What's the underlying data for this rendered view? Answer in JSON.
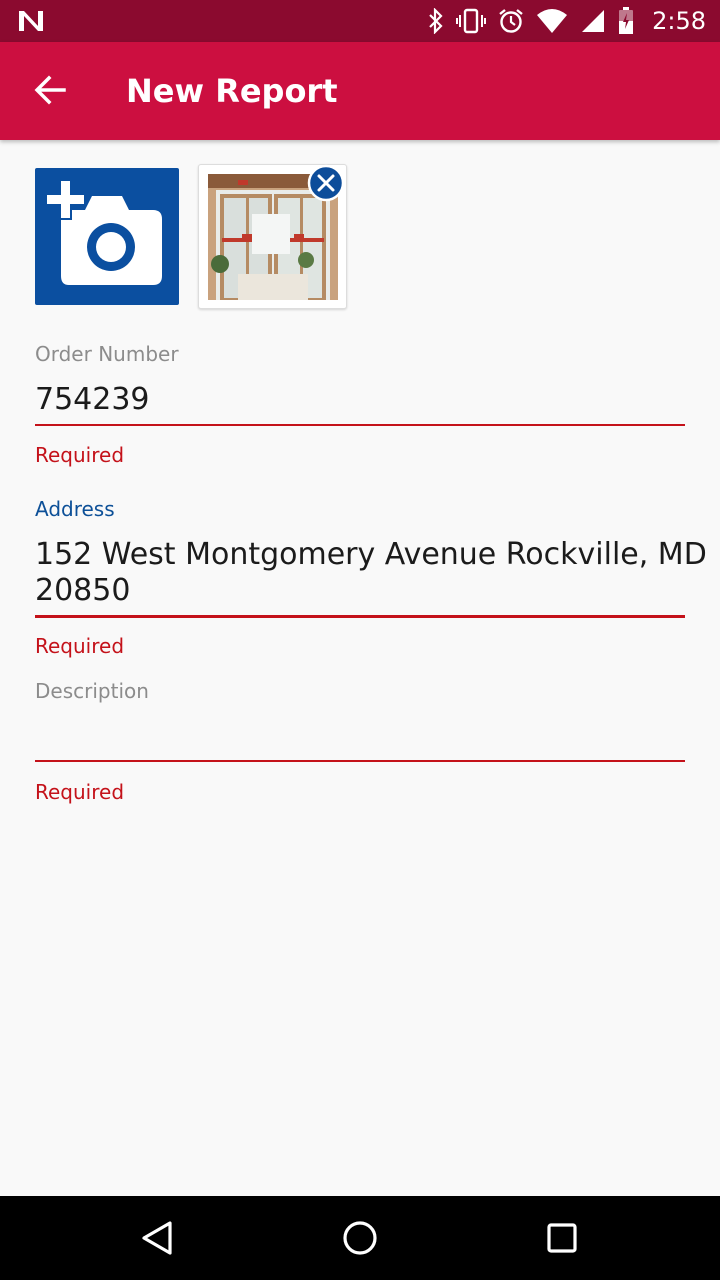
{
  "status_bar": {
    "time": "2:58",
    "icons": [
      "notification-n-icon",
      "bluetooth-icon",
      "vibrate-icon",
      "alarm-icon",
      "wifi-icon",
      "cellular-icon",
      "battery-icon"
    ]
  },
  "app_bar": {
    "title": "New Report",
    "color": "#cc0f40"
  },
  "photos": {
    "add_photo_color": "#0b4fa0",
    "items": [
      {
        "remove_icon": "close-circle-icon"
      }
    ]
  },
  "form": {
    "order_number": {
      "label": "Order Number",
      "value": "754239",
      "error": "Required"
    },
    "address": {
      "label": "Address",
      "value_line1": "152 West Montgomery Avenue Rockville, MD",
      "value_line2": "20850",
      "error": "Required"
    },
    "description": {
      "label": "Description",
      "value": "",
      "error": "Required"
    }
  },
  "colors": {
    "status_bar": "#8b0a2f",
    "error": "#c4121a",
    "focused_label": "#0d5098"
  },
  "nav_bar": {
    "icons": [
      "back-triangle-icon",
      "home-circle-icon",
      "recents-square-icon"
    ]
  }
}
